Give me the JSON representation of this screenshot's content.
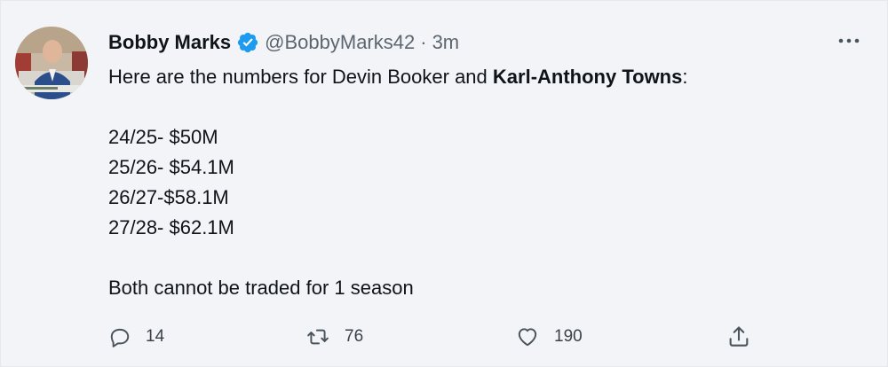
{
  "tweet": {
    "display_name": "Bobby Marks",
    "handle": "@BobbyMarks42",
    "separator": "·",
    "time": "3m",
    "text": {
      "intro_prefix": "Here are the numbers for Devin Booker and ",
      "intro_bold": "Karl-Anthony Towns",
      "intro_suffix": ":",
      "lines": [
        "24/25- $50M",
        "25/26- $54.1M",
        "26/27-$58.1M",
        "27/28- $62.1M"
      ],
      "closing": "Both cannot be traded for 1 season"
    },
    "stats": {
      "replies": "14",
      "retweets": "76",
      "likes": "190"
    }
  },
  "colors": {
    "verified_blue": "#1d9bf0",
    "secondary_text": "#5b6670",
    "icon_gray": "#4a545d"
  },
  "icons": {
    "verified": "verified-badge-icon",
    "more": "more-dots-icon",
    "reply": "reply-icon",
    "retweet": "retweet-icon",
    "like": "heart-icon",
    "share": "share-icon"
  }
}
